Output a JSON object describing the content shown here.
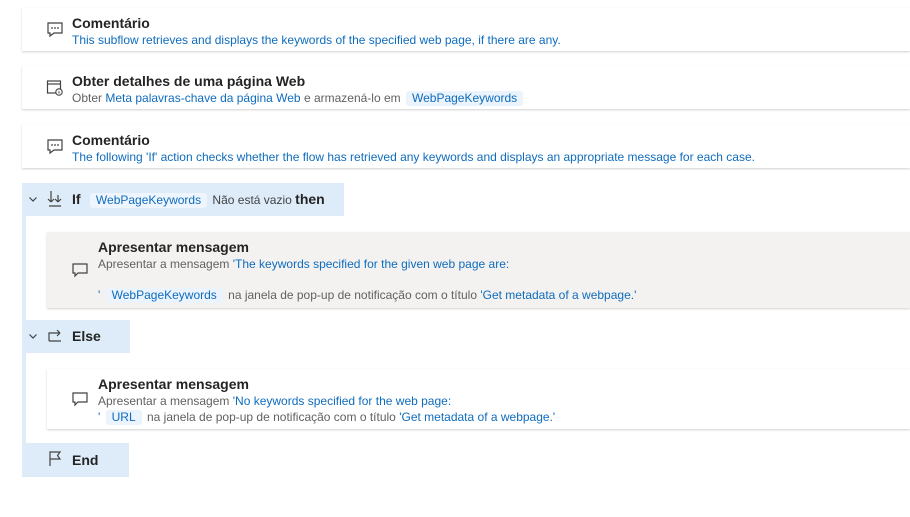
{
  "steps": [
    {
      "title": "Comentário",
      "text": "This subflow retrieves and displays the keywords of the specified web page, if there are any."
    },
    {
      "title": "Obter detalhes de uma página Web",
      "pre": "Obter",
      "link": "Meta palavras-chave da página Web",
      "mid": "e armazená-lo em",
      "var": "WebPageKeywords"
    },
    {
      "title": "Comentário",
      "text": "The following 'If' action checks whether the flow has retrieved any keywords and displays an appropriate message for each case."
    }
  ],
  "if_block": {
    "keyword": "If",
    "variable": "WebPageKeywords",
    "condition": "Não está vazio",
    "then": "then"
  },
  "msg1": {
    "title": "Apresentar mensagem",
    "pre": "Apresentar a mensagem",
    "text_line1": "'The keywords specified for the given web page are:",
    "quote": "'",
    "var": "WebPageKeywords",
    "mid": "na janela de pop-up de notificação com o título",
    "title_value": "'Get metadata of a webpage.'"
  },
  "else_block": {
    "keyword": "Else"
  },
  "msg2": {
    "title": "Apresentar mensagem",
    "pre": "Apresentar a mensagem",
    "text_line1": "'No keywords specified for the web page:",
    "quote": "'",
    "var": "URL",
    "mid": "na janela de pop-up de notificação com o título",
    "title_value": "'Get metadata of a webpage.'"
  },
  "end_block": {
    "keyword": "End"
  },
  "colors": {
    "accent": "#0f6cbd",
    "block_bar": "#deecf9",
    "selected_bg": "#f3f2f1"
  },
  "icons": [
    "comment-icon",
    "web-page-details-icon",
    "if-icon",
    "else-icon",
    "end-flag-icon",
    "message-icon",
    "chevron-down-icon"
  ]
}
